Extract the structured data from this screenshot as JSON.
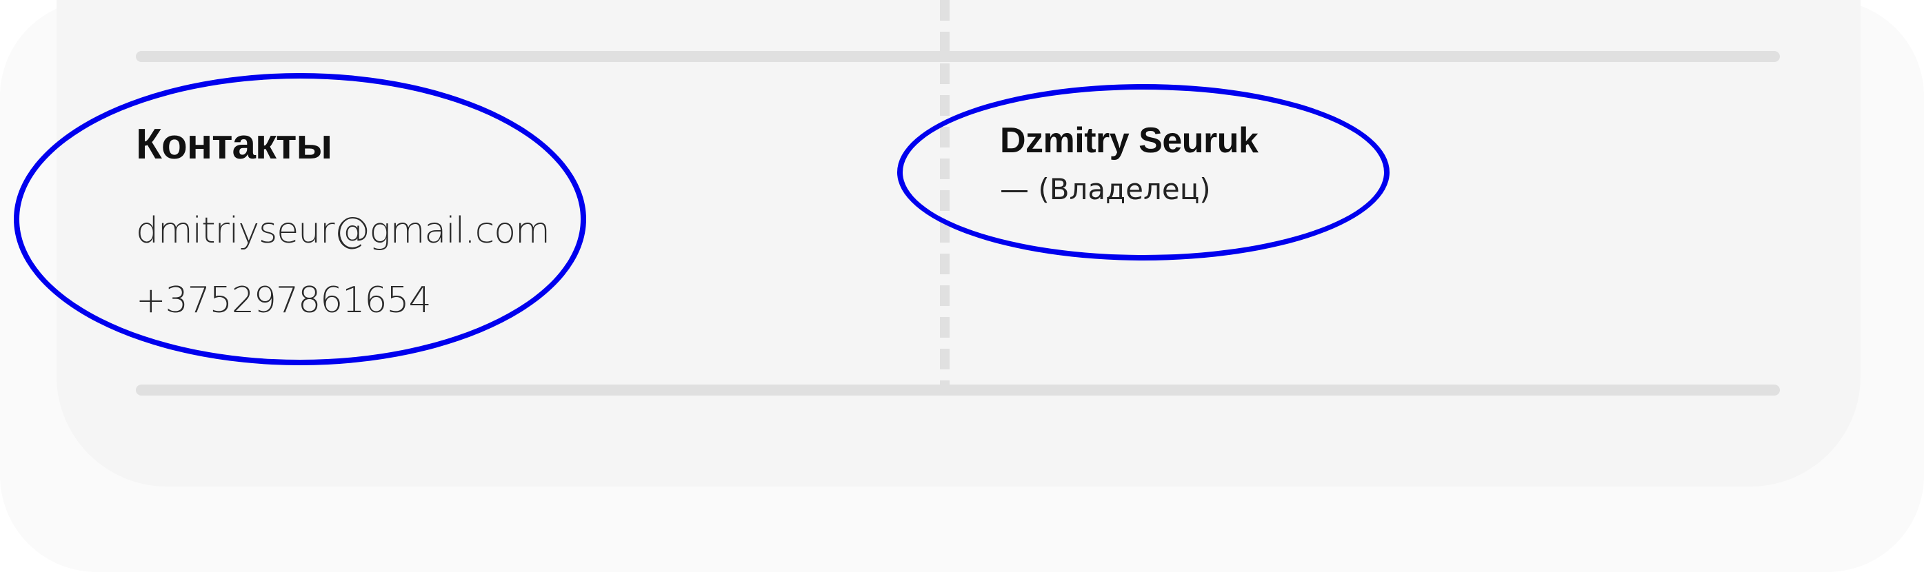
{
  "contacts": {
    "title": "Контакты",
    "email": "dmitriyseur@gmail.com",
    "phone": "+375297861654"
  },
  "owner": {
    "name": "Dzmitry Seuruk",
    "role": "— (Владелец)"
  },
  "colors": {
    "highlight_ring": "#0000ee",
    "card_background": "#f5f5f5",
    "divider": "#e0e0e0"
  }
}
